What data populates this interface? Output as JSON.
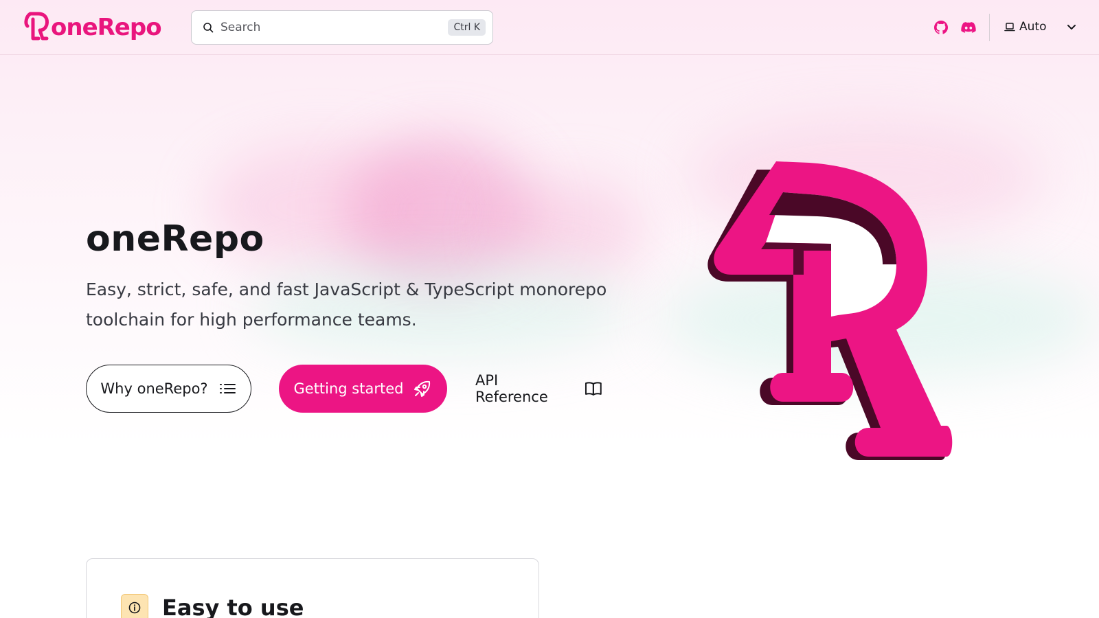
{
  "header": {
    "logo_text": "oneRepo",
    "search": {
      "placeholder": "Search",
      "shortcut": "Ctrl K"
    },
    "github_icon": "github-icon",
    "discord_icon": "discord-icon",
    "theme_select": {
      "value": "Auto",
      "icon": "laptop-icon"
    }
  },
  "hero": {
    "title": "oneRepo",
    "tagline": "Easy, strict, safe, and fast JavaScript & TypeScript monorepo toolchain for high performance teams.",
    "buttons": [
      {
        "label": "Why oneRepo?",
        "icon": "list-icon"
      },
      {
        "label": "Getting started",
        "icon": "rocket-icon"
      },
      {
        "label": "API Reference",
        "icon": "book-icon"
      }
    ]
  },
  "features": [
    {
      "title": "Easy to use",
      "icon": "info-icon"
    }
  ],
  "colors": {
    "brand": "#ec1584",
    "brand_dark": "#4a0827",
    "text": "#17181c",
    "card_icon_bg": "#fde4b2"
  }
}
